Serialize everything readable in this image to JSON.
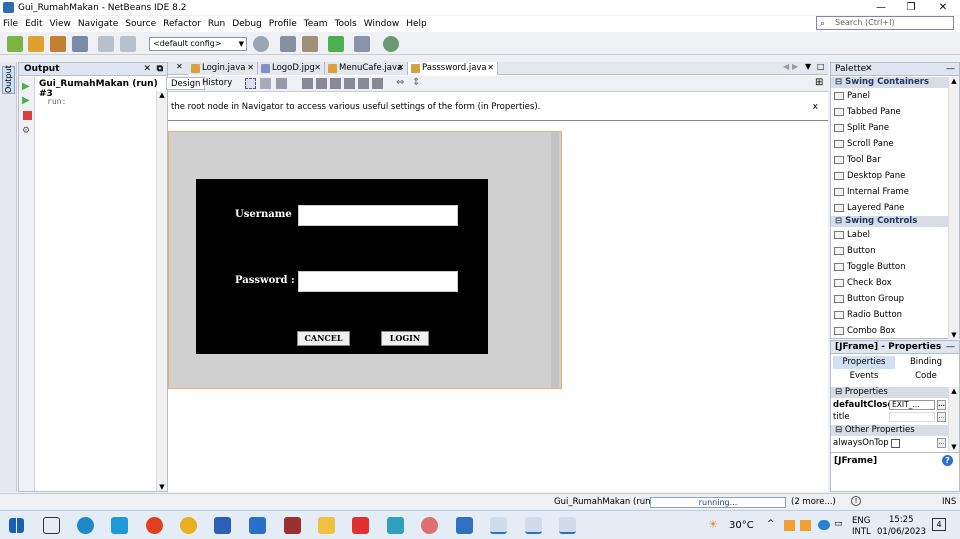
{
  "window": {
    "title": "Gui_RumahMakan - NetBeans IDE 8.2"
  },
  "menu": [
    "File",
    "Edit",
    "View",
    "Navigate",
    "Source",
    "Refactor",
    "Run",
    "Debug",
    "Profile",
    "Team",
    "Tools",
    "Window",
    "Help"
  ],
  "search": {
    "placeholder": "Search (Ctrl+I)"
  },
  "toolbar": {
    "config": "<default config>"
  },
  "output": {
    "vtab": "Output",
    "header": "Output",
    "run_title": "Gui_RumahMakan (run) #3",
    "line": "run:"
  },
  "editor": {
    "tabs": [
      "Login.java",
      "LogoD.jpg",
      "MenuCafe.java",
      "Passsword.java"
    ],
    "design_tab": "Design",
    "history_tab": "History",
    "hint": "the root node in Navigator to access various useful settings of the form (in Properties)."
  },
  "form": {
    "username_label": "Username",
    "password_label": "Password :",
    "cancel_label": "CANCEL",
    "login_label": "LOGIN"
  },
  "palette": {
    "header": "Palette",
    "sections": [
      {
        "title": "Swing Containers",
        "items": [
          "Panel",
          "Tabbed Pane",
          "Split Pane",
          "Scroll Pane",
          "Tool Bar",
          "Desktop Pane",
          "Internal Frame",
          "Layered Pane"
        ]
      },
      {
        "title": "Swing Controls",
        "items": [
          "Label",
          "Button",
          "Toggle Button",
          "Check Box",
          "Button Group",
          "Radio Button",
          "Combo Box"
        ]
      }
    ]
  },
  "properties": {
    "header": "[JFrame] - Properties",
    "tabs": [
      "Properties",
      "Binding",
      "Events",
      "Code"
    ],
    "section1": "Properties",
    "rows": [
      {
        "name": "defaultCloseO",
        "value": "EXIT_..."
      },
      {
        "name": "title",
        "value": ""
      }
    ],
    "section2": "Other Properties",
    "row3": "alwaysOnTop",
    "footer": "[JFrame]"
  },
  "status": {
    "task": "Gui_RumahMakan (run) #3",
    "progress": "running...",
    "more": "(2 more...)",
    "mode": "INS"
  },
  "taskbar": {
    "temp": "30°C",
    "lang1": "ENG",
    "lang2": "INTL",
    "time": "15:25",
    "date": "01/06/2023",
    "badge": "4"
  }
}
